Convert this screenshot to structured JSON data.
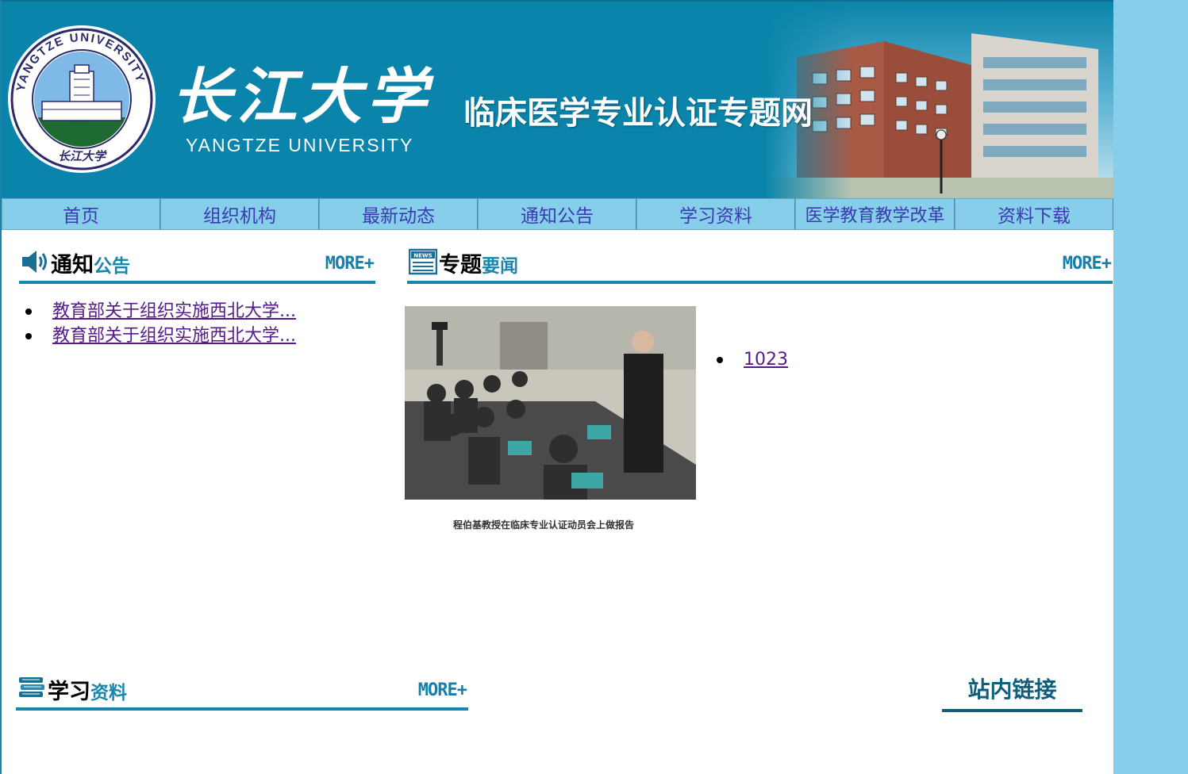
{
  "header": {
    "university_cn": "长江大学",
    "university_en": "YANGTZE UNIVERSITY",
    "emblem_ring_text": "YANGTZE UNIVERSITY",
    "site_title": "临床医学专业认证专题网"
  },
  "nav": {
    "items": [
      {
        "label": "首页"
      },
      {
        "label": "组织机构"
      },
      {
        "label": "最新动态"
      },
      {
        "label": "通知公告"
      },
      {
        "label": "学习资料"
      },
      {
        "label": "医学教育教学改革"
      },
      {
        "label": "资料下载"
      }
    ]
  },
  "notices": {
    "title_a": "通知",
    "title_b": "公告",
    "more": "MORE+",
    "items": [
      {
        "text": "教育部关于组织实施西北大学..."
      },
      {
        "text": "教育部关于组织实施西北大学..."
      }
    ]
  },
  "news": {
    "title_a": "专题",
    "title_b": "要闻",
    "icon_text": "NEWS",
    "more": "MORE+",
    "photo_caption": "程伯基教授在临床专业认证动员会上做报告",
    "items": [
      {
        "text": "1023"
      }
    ]
  },
  "study": {
    "title_a": "学习",
    "title_b": "资料",
    "more": "MORE+"
  },
  "site_links": {
    "title": "站内链接"
  },
  "colors": {
    "banner": "#0a84aa",
    "nav_bg": "#87ceeb",
    "accent": "#1a85ad",
    "link": "#551a8b"
  }
}
